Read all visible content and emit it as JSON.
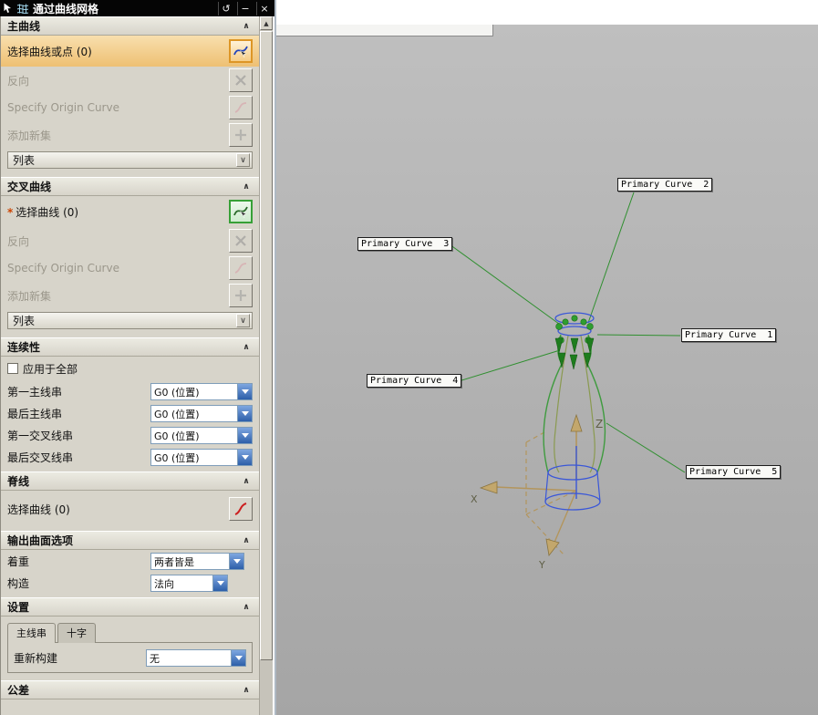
{
  "icons": {
    "collapse": "∧",
    "list_chevron": "∨",
    "scroll_up": "▲",
    "reset": "↺",
    "minimize": "−",
    "close": "×"
  },
  "titlebar": {
    "title": "通过曲线网格"
  },
  "panel": {
    "primary": {
      "header": "主曲线",
      "select_label": "选择曲线或点 (0)",
      "reverse_label": "反向",
      "origin_label": "Specify Origin Curve",
      "add_label": "添加新集",
      "list_label": "列表"
    },
    "cross": {
      "header": "交叉曲线",
      "required": "*",
      "select_label": "选择曲线 (0)",
      "reverse_label": "反向",
      "origin_label": "Specify Origin Curve",
      "add_label": "添加新集",
      "list_label": "列表"
    },
    "continuity": {
      "header": "连续性",
      "apply_all": "应用于全部",
      "rows": [
        {
          "label": "第一主线串",
          "value": "G0 (位置)"
        },
        {
          "label": "最后主线串",
          "value": "G0 (位置)"
        },
        {
          "label": "第一交叉线串",
          "value": "G0 (位置)"
        },
        {
          "label": "最后交叉线串",
          "value": "G0 (位置)"
        }
      ]
    },
    "spine": {
      "header": "脊线",
      "select_label": "选择曲线 (0)"
    },
    "output": {
      "header": "输出曲面选项",
      "rows": [
        {
          "label": "着重",
          "value": "两者皆是"
        },
        {
          "label": "构造",
          "value": "法向"
        }
      ]
    },
    "settings": {
      "header": "设置",
      "tabs": [
        "主线串",
        "十字"
      ],
      "rebuild_label": "重新构建",
      "rebuild_value": "无"
    },
    "tolerance": {
      "header": "公差"
    }
  },
  "viewport": {
    "labels": [
      {
        "text": "Primary Curve  2"
      },
      {
        "text": "Primary Curve  3"
      },
      {
        "text": "Primary Curve  1"
      },
      {
        "text": "Primary Curve  4"
      },
      {
        "text": "Primary Curve  5"
      }
    ],
    "axes": {
      "x": "X",
      "y": "Y",
      "z": "Z"
    }
  },
  "colors": {
    "highlight_orange": "#e89a2f",
    "highlight_green": "#37a037",
    "curve_green": "#3f9b3f",
    "curve_blue": "#3a57d8",
    "wcs_tan": "#b3955c"
  }
}
